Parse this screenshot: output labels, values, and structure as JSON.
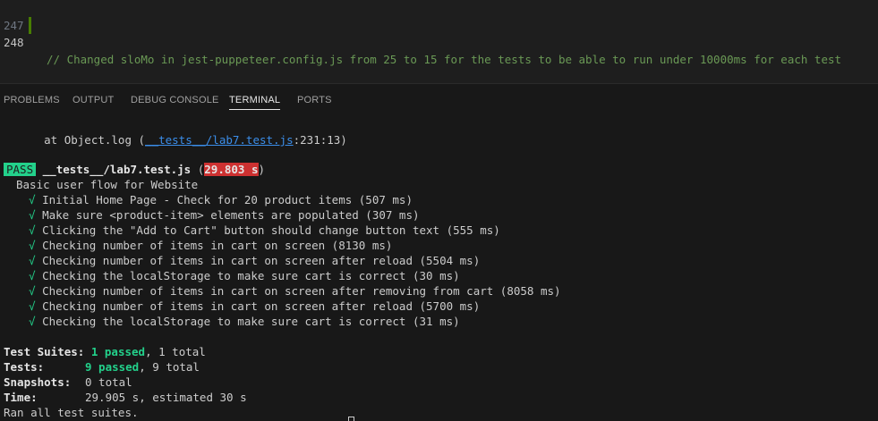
{
  "editor": {
    "lines": [
      {
        "number": "247",
        "text": ""
      },
      {
        "number": "248",
        "text": "// Changed sloMo in jest-puppeteer.config.js from 25 to 15 for the tests to be able to run under 10000ms for each test"
      }
    ]
  },
  "panel": {
    "tabs": [
      {
        "label": "PROBLEMS"
      },
      {
        "label": "OUTPUT"
      },
      {
        "label": "DEBUG CONSOLE"
      },
      {
        "label": "TERMINAL",
        "active": true
      },
      {
        "label": "PORTS"
      }
    ]
  },
  "terminal": {
    "log_prefix": "      at Object.log (",
    "log_file": "__tests__/lab7.test.js",
    "log_suffix": ":231:13)",
    "pass_label": "PASS",
    "test_file": "__tests__/lab7.test.js",
    "duration": "29.803 s",
    "suite_name": "Basic user flow for Website",
    "check_mark": "√",
    "tests": [
      "Initial Home Page - Check for 20 product items (507 ms)",
      "Make sure <product-item> elements are populated (307 ms)",
      "Clicking the \"Add to Cart\" button should change button text (555 ms)",
      "Checking number of items in cart on screen (8130 ms)",
      "Checking number of items in cart on screen after reload (5504 ms)",
      "Checking the localStorage to make sure cart is correct (30 ms)",
      "Checking number of items in cart on screen after removing from cart (8058 ms)",
      "Checking number of items in cart on screen after reload (5700 ms)",
      "Checking the localStorage to make sure cart is correct (31 ms)"
    ],
    "summary": {
      "suites_label": "Test Suites:",
      "suites_passed": "1 passed",
      "suites_total": ", 1 total",
      "tests_label": "Tests:",
      "tests_passed": "9 passed",
      "tests_total": ", 9 total",
      "snapshots_label": "Snapshots:",
      "snapshots_value": "0 total",
      "time_label": "Time:",
      "time_value": "29.905 s, estimated 30 s"
    },
    "footer": "Ran all test suites."
  },
  "colors": {
    "pass_green": "#23d18b",
    "fail_red": "#cd3131",
    "comment_green": "#6a9955",
    "link_blue": "#3b8eea"
  }
}
